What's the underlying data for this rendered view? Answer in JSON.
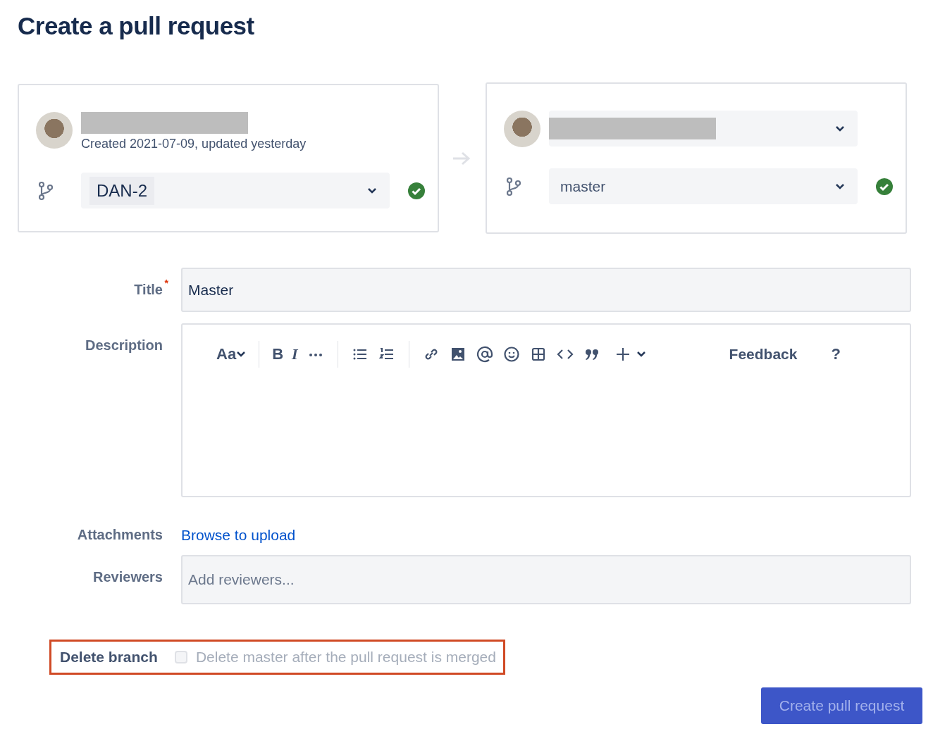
{
  "page_title": "Create a pull request",
  "source": {
    "meta": "Created 2021-07-09, updated yesterday",
    "branch": "DAN-2",
    "branch_valid": true
  },
  "destination": {
    "branch": "master",
    "branch_valid": true
  },
  "form": {
    "title_label": "Title",
    "title_required_mark": "*",
    "title_value": "Master",
    "description_label": "Description",
    "toolbar": {
      "text_style": "Aa",
      "bold": "B",
      "italic": "I",
      "feedback": "Feedback",
      "help": "?"
    },
    "attachments_label": "Attachments",
    "attachments_link": "Browse to upload",
    "reviewers_label": "Reviewers",
    "reviewers_placeholder": "Add reviewers...",
    "delete_branch": {
      "label": "Delete branch",
      "text": "Delete master after the pull request is merged",
      "checked": false,
      "disabled": true,
      "highlighted": true
    }
  },
  "submit": {
    "label": "Create pull request",
    "disabled": true
  }
}
